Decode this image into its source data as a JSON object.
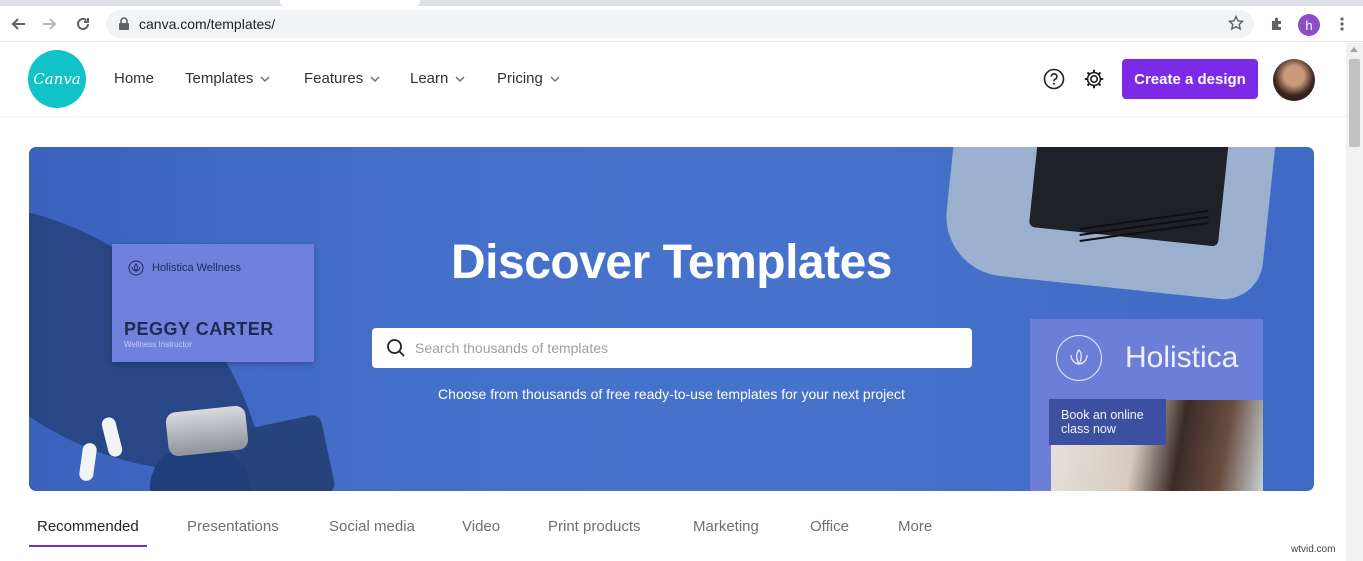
{
  "browser": {
    "url": "canva.com/templates/",
    "profile_initial": "h"
  },
  "header": {
    "logo_text": "Canva",
    "nav": [
      {
        "label": "Home"
      },
      {
        "label": "Templates"
      },
      {
        "label": "Features"
      },
      {
        "label": "Learn"
      },
      {
        "label": "Pricing"
      }
    ],
    "cta_label": "Create a design",
    "brand_color": "#7d2ae8",
    "logo_color": "#12c2c9"
  },
  "hero": {
    "title": "Discover Templates",
    "search_placeholder": "Search thousands of templates",
    "subtitle": "Choose from thousands of free ready-to-use templates for your next project",
    "business_card": {
      "brand": "Holistica Wellness",
      "name": "PEGGY CARTER",
      "role": "Wellness Instructor"
    },
    "poster": {
      "brand": "Holistica",
      "tagline": "Book an online class now"
    }
  },
  "tabs": [
    {
      "label": "Recommended",
      "active": true
    },
    {
      "label": "Presentations"
    },
    {
      "label": "Social media"
    },
    {
      "label": "Video"
    },
    {
      "label": "Print products"
    },
    {
      "label": "Marketing"
    },
    {
      "label": "Office"
    },
    {
      "label": "More"
    }
  ],
  "watermark": "wtvid.com"
}
